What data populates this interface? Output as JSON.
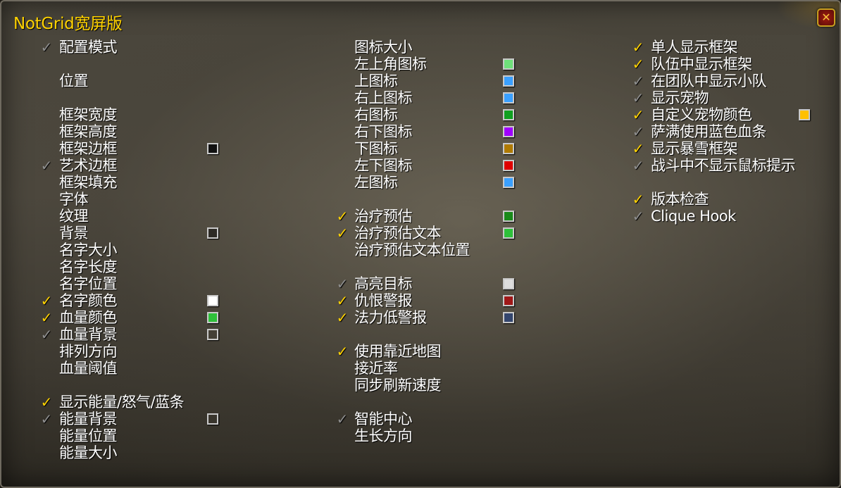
{
  "window": {
    "title": "NotGrid宽屏版",
    "close_icon": "close-icon"
  },
  "columns": [
    {
      "items": [
        {
          "label": "配置模式",
          "check": "off"
        },
        {
          "label": "位置"
        },
        {
          "label": "框架宽度"
        },
        {
          "label": "框架高度"
        },
        {
          "label": "框架边框",
          "color": "#111111"
        },
        {
          "label": "艺术边框",
          "check": "off"
        },
        {
          "label": "框架填充"
        },
        {
          "label": "字体"
        },
        {
          "label": "纹理"
        },
        {
          "label": "背景",
          "color": "#2e2b26"
        },
        {
          "label": "名字大小"
        },
        {
          "label": "名字长度"
        },
        {
          "label": "名字位置"
        },
        {
          "label": "名字颜色",
          "check": "on",
          "color": "#ffffff"
        },
        {
          "label": "血量颜色",
          "check": "on",
          "color": "#2ec03a"
        },
        {
          "label": "血量背景",
          "check": "off",
          "color": "transparent"
        },
        {
          "label": "排列方向"
        },
        {
          "label": "血量阈值"
        },
        {
          "label": "显示能量/怒气/蓝条",
          "check": "on"
        },
        {
          "label": "能量背景",
          "check": "off",
          "color": "transparent"
        },
        {
          "label": "能量位置"
        },
        {
          "label": "能量大小"
        }
      ]
    },
    {
      "items": [
        {
          "label": "图标大小"
        },
        {
          "label": "左上角图标",
          "color": "#6fe07a"
        },
        {
          "label": "上图标",
          "color": "#3aa0ff"
        },
        {
          "label": "右上图标",
          "color": "#3aa0ff"
        },
        {
          "label": "右图标",
          "color": "#10a020"
        },
        {
          "label": "右下图标",
          "color": "#a000ff"
        },
        {
          "label": "下图标",
          "color": "#b07a00"
        },
        {
          "label": "左下图标",
          "color": "#e00000"
        },
        {
          "label": "左图标",
          "color": "#3aa0ff"
        },
        {
          "label": "治疗预估",
          "check": "on",
          "color": "#1a8a1a"
        },
        {
          "label": "治疗预估文本",
          "check": "on",
          "color": "#2ec03a"
        },
        {
          "label": "治疗预估文本位置"
        },
        {
          "label": "高亮目标",
          "check": "off",
          "color": "#dddddd"
        },
        {
          "label": "仇恨警报",
          "check": "on",
          "color": "#a01818"
        },
        {
          "label": "法力低警报",
          "check": "on",
          "color": "#34466e"
        },
        {
          "label": "使用靠近地图",
          "check": "on"
        },
        {
          "label": "接近率"
        },
        {
          "label": "同步刷新速度"
        },
        {
          "label": "智能中心",
          "check": "off"
        },
        {
          "label": "生长方向"
        }
      ]
    },
    {
      "items": [
        {
          "label": "单人显示框架",
          "check": "on"
        },
        {
          "label": "队伍中显示框架",
          "check": "on"
        },
        {
          "label": "在团队中显示小队",
          "check": "off"
        },
        {
          "label": "显示宠物",
          "check": "off"
        },
        {
          "label": "自定义宠物颜色",
          "check": "on",
          "color": "#ffc000"
        },
        {
          "label": "萨满使用蓝色血条",
          "check": "off"
        },
        {
          "label": "显示暴雪框架",
          "check": "on"
        },
        {
          "label": "战斗中不显示鼠标提示",
          "check": "off"
        },
        {
          "label": "版本检查",
          "check": "on"
        },
        {
          "label": "Clique Hook",
          "check": "off"
        }
      ]
    }
  ],
  "colors": {
    "title": "#ffd200",
    "check_on": "#ffd200",
    "check_off": "#8e8e8e",
    "text": "#ffffff"
  }
}
